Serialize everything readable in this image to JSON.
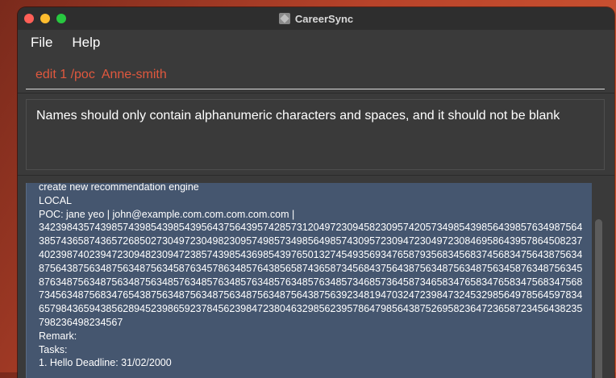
{
  "window": {
    "title": "CareerSync"
  },
  "menu": {
    "items": [
      "File",
      "Help"
    ]
  },
  "command": {
    "value": "edit 1 /poc  Anne-smith"
  },
  "result": {
    "message": "Names should only contain alphanumeric characters and spaces, and it should not be blank"
  },
  "card": {
    "role": "create new recommendation engine",
    "location": "LOCAL",
    "poc": "POC: jane yeo | john@example.com.com.com.com.com |",
    "phone": "3423984357439857439854398543956437564395742857312049723094582309574205734985439856439857634987564385743658743657268502730497230498230957498573498564985743095723094723049723084695864395786450823740239874023947230948230947238574398543698543976501327454935693476587935683456837456834756438756348756438756348756348756345876345786348576438565874365873456843756438756348756348756345876348756345876348756348756348756348576348576348576348576348576348573468573645873465834765834765834756834756873456348756834765438756348756348756348756348756438756392348194703247239847324532985649785645978346579843659438562894523986592378456239847238046329856239578647985643875269582364723658723456438235798236498234567",
    "remark": "Remark:",
    "tasks": "Tasks:",
    "task1": "1. Hello Deadline: 31/02/2000"
  },
  "colors": {
    "command_text": "#e0583e",
    "list_bg": "#45566f"
  }
}
